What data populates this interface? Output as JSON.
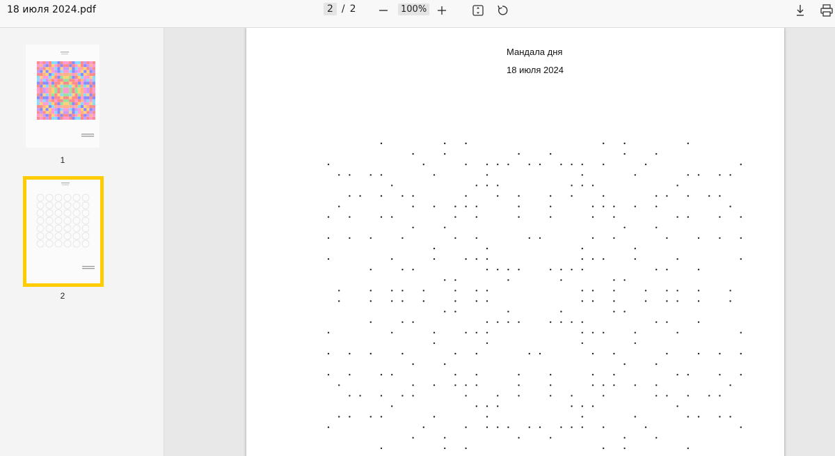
{
  "toolbar": {
    "file_name": "18 июля 2024.pdf",
    "current_page": "2",
    "separator": "/",
    "total_pages": "2",
    "zoom": "100%",
    "icons": {
      "zoom_out": "minus-icon",
      "zoom_in": "plus-icon",
      "fit": "fit-page-icon",
      "rotate": "rotate-icon",
      "download": "download-icon",
      "print": "print-icon"
    }
  },
  "sidebar": {
    "thumbnails": [
      {
        "label": "1",
        "selected": false
      },
      {
        "label": "2",
        "selected": true
      }
    ],
    "selection_color": "#ffcc00"
  },
  "page": {
    "title": "Мандала дня",
    "date": "18 июля 2024"
  }
}
